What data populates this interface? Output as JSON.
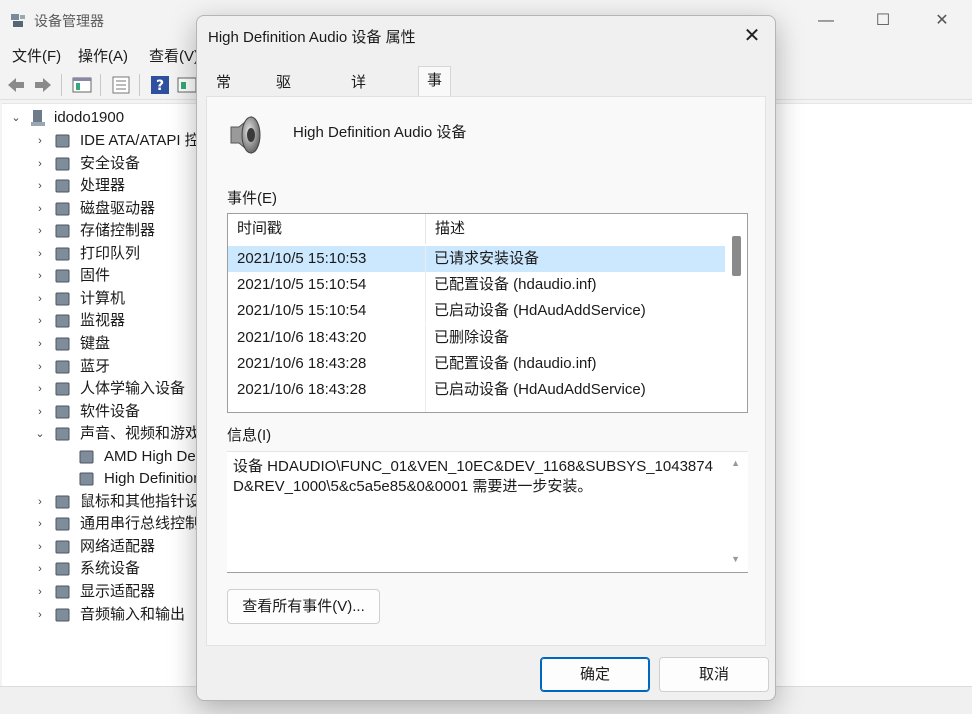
{
  "device_manager": {
    "title": "设备管理器",
    "window_controls": [
      "—",
      "☐",
      "✕"
    ],
    "menus": [
      "文件(F)",
      "操作(A)",
      "查看(V)"
    ],
    "tree": {
      "root": "idodo1900",
      "items": [
        {
          "label": "IDE ATA/ATAPI 控制器",
          "expanded": false,
          "icon": "ide-controller-icon"
        },
        {
          "label": "安全设备",
          "expanded": false,
          "icon": "security-device-icon"
        },
        {
          "label": "处理器",
          "expanded": false,
          "icon": "processor-icon"
        },
        {
          "label": "磁盘驱动器",
          "expanded": false,
          "icon": "disk-drive-icon"
        },
        {
          "label": "存储控制器",
          "expanded": false,
          "icon": "storage-controller-icon"
        },
        {
          "label": "打印队列",
          "expanded": false,
          "icon": "printer-icon"
        },
        {
          "label": "固件",
          "expanded": false,
          "icon": "firmware-icon"
        },
        {
          "label": "计算机",
          "expanded": false,
          "icon": "computer-icon"
        },
        {
          "label": "监视器",
          "expanded": false,
          "icon": "monitor-icon"
        },
        {
          "label": "键盘",
          "expanded": false,
          "icon": "keyboard-icon"
        },
        {
          "label": "蓝牙",
          "expanded": false,
          "icon": "bluetooth-icon"
        },
        {
          "label": "人体学输入设备",
          "expanded": false,
          "icon": "hid-icon"
        },
        {
          "label": "软件设备",
          "expanded": false,
          "icon": "software-device-icon"
        },
        {
          "label": "声音、视频和游戏控制器",
          "expanded": true,
          "icon": "speaker-icon"
        },
        {
          "label": "AMD High Definition Audio Device",
          "child": true,
          "icon": "speaker-icon"
        },
        {
          "label": "High Definition Audio 设备",
          "child": true,
          "icon": "speaker-icon"
        },
        {
          "label": "鼠标和其他指针设备",
          "expanded": false,
          "icon": "mouse-icon"
        },
        {
          "label": "通用串行总线控制器",
          "expanded": false,
          "icon": "usb-icon"
        },
        {
          "label": "网络适配器",
          "expanded": false,
          "icon": "network-adapter-icon"
        },
        {
          "label": "系统设备",
          "expanded": false,
          "icon": "system-device-icon"
        },
        {
          "label": "显示适配器",
          "expanded": false,
          "icon": "display-adapter-icon"
        },
        {
          "label": "音频输入和输出",
          "expanded": false,
          "icon": "audio-io-icon"
        }
      ]
    }
  },
  "dialog": {
    "title": "High Definition Audio 设备 属性",
    "tabs": [
      "常规",
      "驱动程序",
      "详细信息",
      "事件"
    ],
    "active_tab": "事件",
    "device_name": "High Definition Audio 设备",
    "events_label": "事件(E)",
    "columns": [
      "时间戳",
      "描述"
    ],
    "events": [
      {
        "time": "2021/10/5 15:10:53",
        "desc": "已请求安装设备",
        "selected": true
      },
      {
        "time": "2021/10/5 15:10:54",
        "desc": "已配置设备 (hdaudio.inf)"
      },
      {
        "time": "2021/10/5 15:10:54",
        "desc": "已启动设备 (HdAudAddService)"
      },
      {
        "time": "2021/10/6 18:43:20",
        "desc": "已删除设备"
      },
      {
        "time": "2021/10/6 18:43:28",
        "desc": "已配置设备 (hdaudio.inf)"
      },
      {
        "time": "2021/10/6 18:43:28",
        "desc": "已启动设备 (HdAudAddService)"
      }
    ],
    "info_label": "信息(I)",
    "info_text": "设备 HDAUDIO\\FUNC_01&VEN_10EC&DEV_1168&SUBSYS_1043874D&REV_1000\\5&c5a5e85&0&0001 需要进一步安装。",
    "view_all_button": "查看所有事件(V)...",
    "ok_button": "确定",
    "cancel_button": "取消",
    "accent_color": "#0067c0",
    "selection_color": "#cce8ff"
  }
}
